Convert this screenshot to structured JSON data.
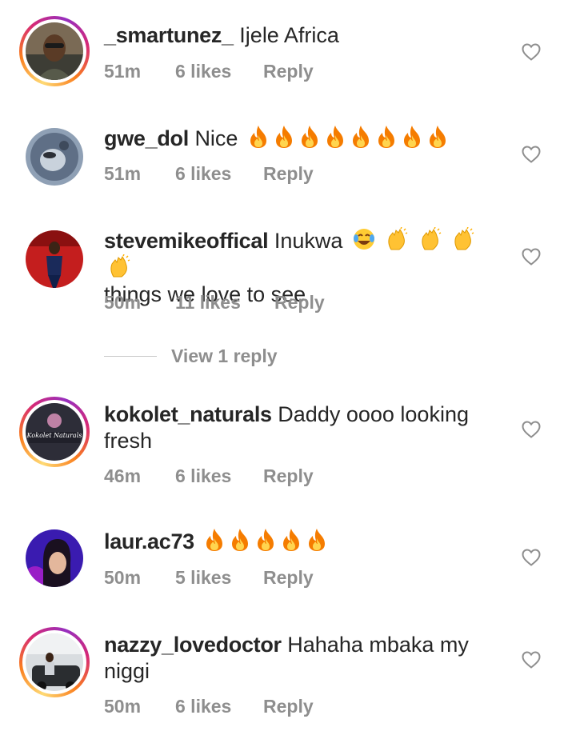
{
  "comments": [
    {
      "username": "_smartunez_",
      "text": "Ijele Africa",
      "time": "51m",
      "likes": "6 likes",
      "reply": "Reply"
    },
    {
      "username": "gwe_dol",
      "text": "Nice",
      "time": "51m",
      "likes": "6 likes",
      "reply": "Reply",
      "emoji": "fire",
      "emoji_count": 8
    },
    {
      "username": "stevemikeoffical",
      "text": "Inukwa",
      "text2": "things we love to see",
      "time": "50m",
      "likes": "11 likes",
      "reply": "Reply"
    },
    {
      "username": "kokolet_naturals",
      "text": "Daddy oooo looking",
      "text2": "fresh",
      "time": "46m",
      "likes": "6 likes",
      "reply": "Reply",
      "avatar_logo": "Kokolet Naturals"
    },
    {
      "username": "laur.ac73",
      "text": "",
      "time": "50m",
      "likes": "5 likes",
      "reply": "Reply",
      "emoji": "fire",
      "emoji_count": 5
    },
    {
      "username": "nazzy_lovedoctor",
      "text": "Hahaha mbaka my",
      "text2": "niggi",
      "time": "50m",
      "likes": "6 likes",
      "reply": "Reply"
    }
  ],
  "view_replies": {
    "label": "View 1 reply"
  },
  "icons": {
    "like": "heart-outline-icon",
    "fire": "fire-emoji",
    "laugh": "tears-of-joy-emoji",
    "clap": "clapping-hands-emoji"
  },
  "colors": {
    "meta": "#8e8e8e",
    "text": "#262626",
    "story_ring": "#d62976"
  }
}
